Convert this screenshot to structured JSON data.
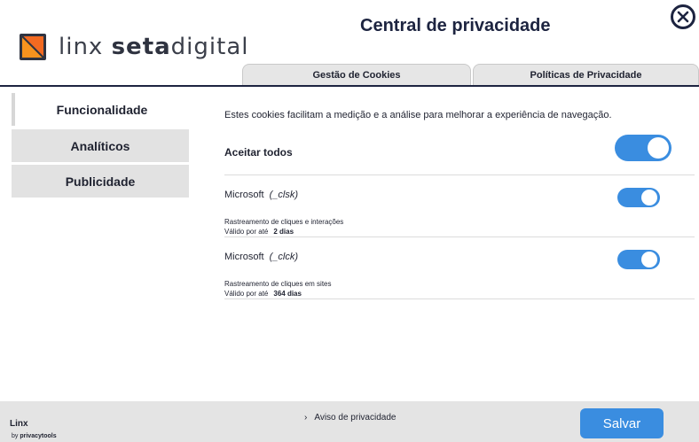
{
  "header": {
    "title": "Central de privacidade",
    "logo": {
      "light": "linx ",
      "bold": "seta",
      "rest": "digital"
    }
  },
  "tabs": [
    {
      "label": "Gestão de Cookies"
    },
    {
      "label": "Políticas de Privacidade"
    }
  ],
  "sidebar": {
    "items": [
      {
        "label": "Funcionalidade",
        "active": true
      },
      {
        "label": "Analíticos",
        "active": false
      },
      {
        "label": "Publicidade",
        "active": false
      }
    ]
  },
  "main": {
    "description": "Estes cookies facilitam a medição e a análise para melhorar a experiência de navegação.",
    "accept_all_label": "Aceitar todos",
    "accept_all_on": true,
    "cookies": [
      {
        "provider": "Microsoft",
        "code": "(_clsk)",
        "description": "Rastreamento de cliques e interações",
        "valid_label": "Válido por até",
        "duration": "2 dias",
        "enabled": true
      },
      {
        "provider": "Microsoft",
        "code": "(_clck)",
        "description": "Rastreamento de cliques em sites",
        "valid_label": "Válido por até",
        "duration": "364 dias",
        "enabled": true
      }
    ]
  },
  "footer": {
    "brand": "Linx",
    "by": "by",
    "by_name": "privacytools",
    "privacy_link": "Aviso de privacidade",
    "save_label": "Salvar"
  },
  "colors": {
    "accent": "#3a8de0",
    "navy": "#1d2440",
    "logo_orange": "#f26a21"
  },
  "icons": [
    "close-icon",
    "chevron-right-icon",
    "linx-logo-icon"
  ]
}
